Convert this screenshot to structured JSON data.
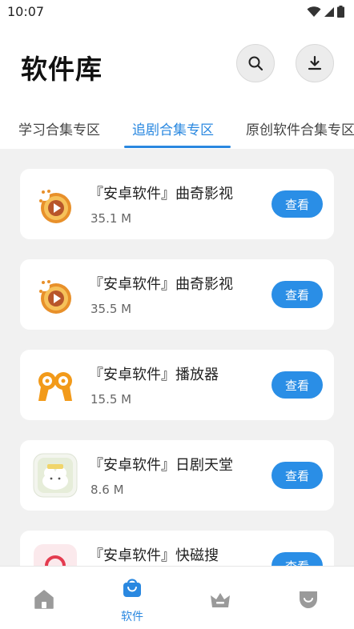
{
  "status_bar": {
    "time": "10:07"
  },
  "header": {
    "title": "软件库"
  },
  "tabs": [
    {
      "label": "学习合集专区"
    },
    {
      "label": "追剧合集专区"
    },
    {
      "label": "原创软件合集专区"
    }
  ],
  "apps": [
    {
      "name": "『安卓软件』曲奇影视",
      "size": "35.1 M",
      "button": "查看"
    },
    {
      "name": "『安卓软件』曲奇影视",
      "size": "35.5 M",
      "button": "查看"
    },
    {
      "name": "『安卓软件』播放器",
      "size": "15.5 M",
      "button": "查看"
    },
    {
      "name": "『安卓软件』日剧天堂",
      "size": "8.6 M",
      "button": "查看"
    },
    {
      "name": "『安卓软件』快磁搜",
      "size": "",
      "button": "查看"
    }
  ],
  "bottom_nav": {
    "items": [
      {
        "icon": "home-icon",
        "label": ""
      },
      {
        "icon": "shopping-bag-icon",
        "label": "软件"
      },
      {
        "icon": "crown-icon",
        "label": ""
      },
      {
        "icon": "shield-icon",
        "label": ""
      }
    ]
  },
  "colors": {
    "accent": "#2a88e0",
    "button": "#2a8ee6",
    "background": "#f1f1f1"
  }
}
